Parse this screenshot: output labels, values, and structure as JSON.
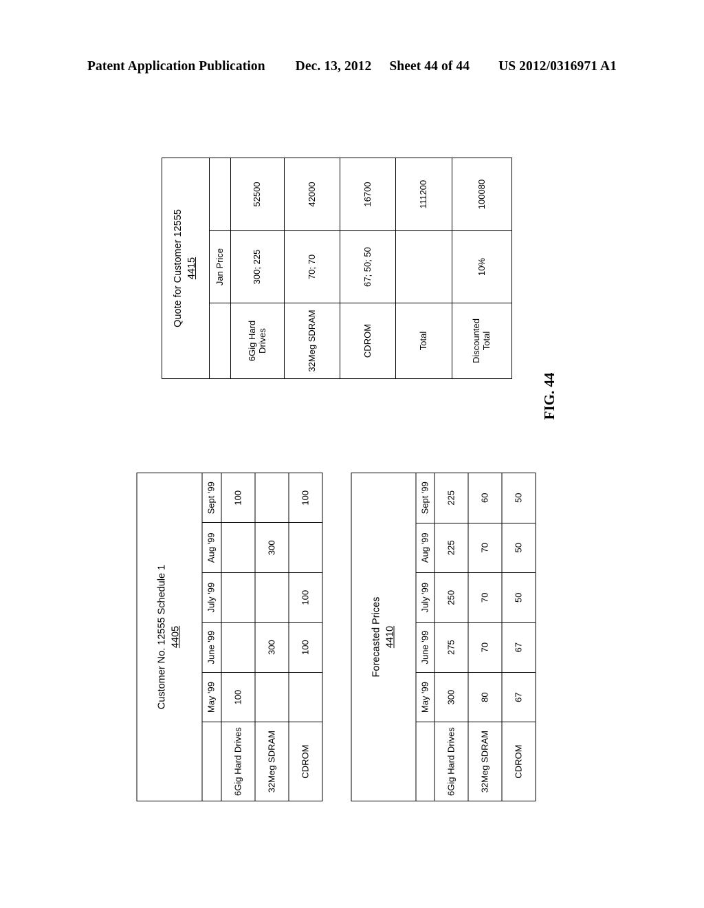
{
  "header": {
    "publication": "Patent Application Publication",
    "date": "Dec. 13, 2012",
    "sheet": "Sheet 44 of 44",
    "patent_number": "US 2012/0316971 A1"
  },
  "figure": {
    "label": "FIG. 44"
  },
  "quote_table": {
    "title": "Quote for Customer 12555",
    "ref": "4415",
    "columns": [
      "",
      "Jan Price",
      ""
    ],
    "rows": [
      {
        "label": "6Gig Hard\nDrives",
        "price": "300; 225",
        "total": "52500"
      },
      {
        "label": "32Meg SDRAM",
        "price": "70; 70",
        "total": "42000"
      },
      {
        "label": "CDROM",
        "price": "67; 50; 50",
        "total": "16700"
      },
      {
        "label": "Total",
        "price": "",
        "total": "111200"
      },
      {
        "label": "Discounted\nTotal",
        "price": "10%",
        "total": "100080"
      }
    ]
  },
  "schedule_table": {
    "title": "Customer No. 12555 Schedule 1",
    "ref": "4405",
    "columns": [
      "",
      "May '99",
      "June '99",
      "July '99",
      "Aug '99",
      "Sept '99"
    ],
    "rows": [
      {
        "label": "6Gig Hard Drives",
        "values": [
          "100",
          "",
          "",
          "",
          "100"
        ]
      },
      {
        "label": "32Meg SDRAM",
        "values": [
          "",
          "300",
          "",
          "300",
          ""
        ]
      },
      {
        "label": "CDROM",
        "values": [
          "",
          "100",
          "100",
          "",
          "100"
        ]
      }
    ]
  },
  "forecast_table": {
    "title": "Forecasted Prices",
    "ref": "4410",
    "columns": [
      "",
      "May '99",
      "June '99",
      "July '99",
      "Aug '99",
      "Sept '99"
    ],
    "rows": [
      {
        "label": "6Gig Hard Drives",
        "values": [
          "300",
          "275",
          "250",
          "225",
          "225"
        ]
      },
      {
        "label": "32Meg SDRAM",
        "values": [
          "80",
          "70",
          "70",
          "70",
          "60"
        ]
      },
      {
        "label": "CDROM",
        "values": [
          "67",
          "67",
          "50",
          "50",
          "50"
        ]
      }
    ]
  }
}
